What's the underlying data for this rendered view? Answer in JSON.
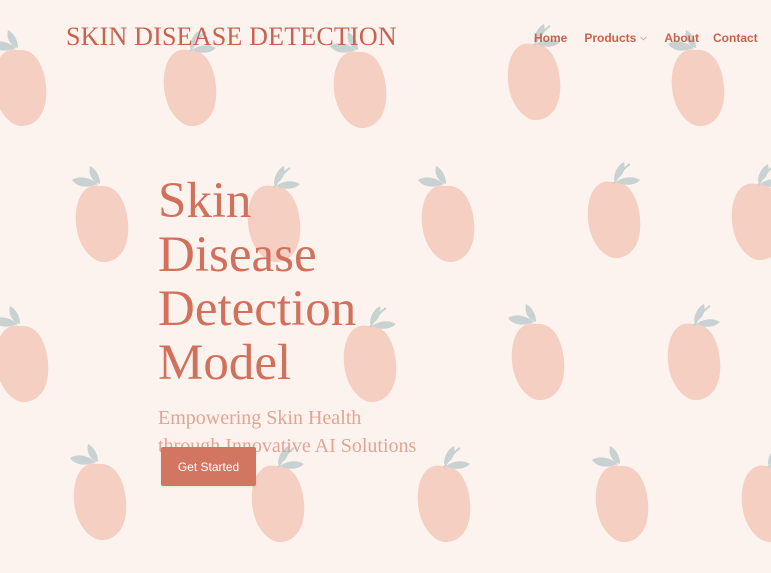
{
  "brand": {
    "name": "SKIN DISEASE DETECTION"
  },
  "nav": {
    "items": [
      {
        "label": "Home"
      },
      {
        "label": "Products",
        "has_dropdown": true
      },
      {
        "label": "About"
      },
      {
        "label": "Contact"
      }
    ]
  },
  "hero": {
    "title": "Skin Disease Detection Model",
    "subtitle": "Empowering Skin Health through Innovative AI Solutions",
    "cta_label": "Get Started"
  },
  "background": {
    "pattern_icon": "peach-icon"
  },
  "colors": {
    "background": "#fdf3ee",
    "accent": "#c9614e",
    "title": "#d1715c",
    "subtitle": "#e2a493",
    "button": "#d27561",
    "peach": "#f6cfc3",
    "leaf": "#c9d2d2"
  }
}
